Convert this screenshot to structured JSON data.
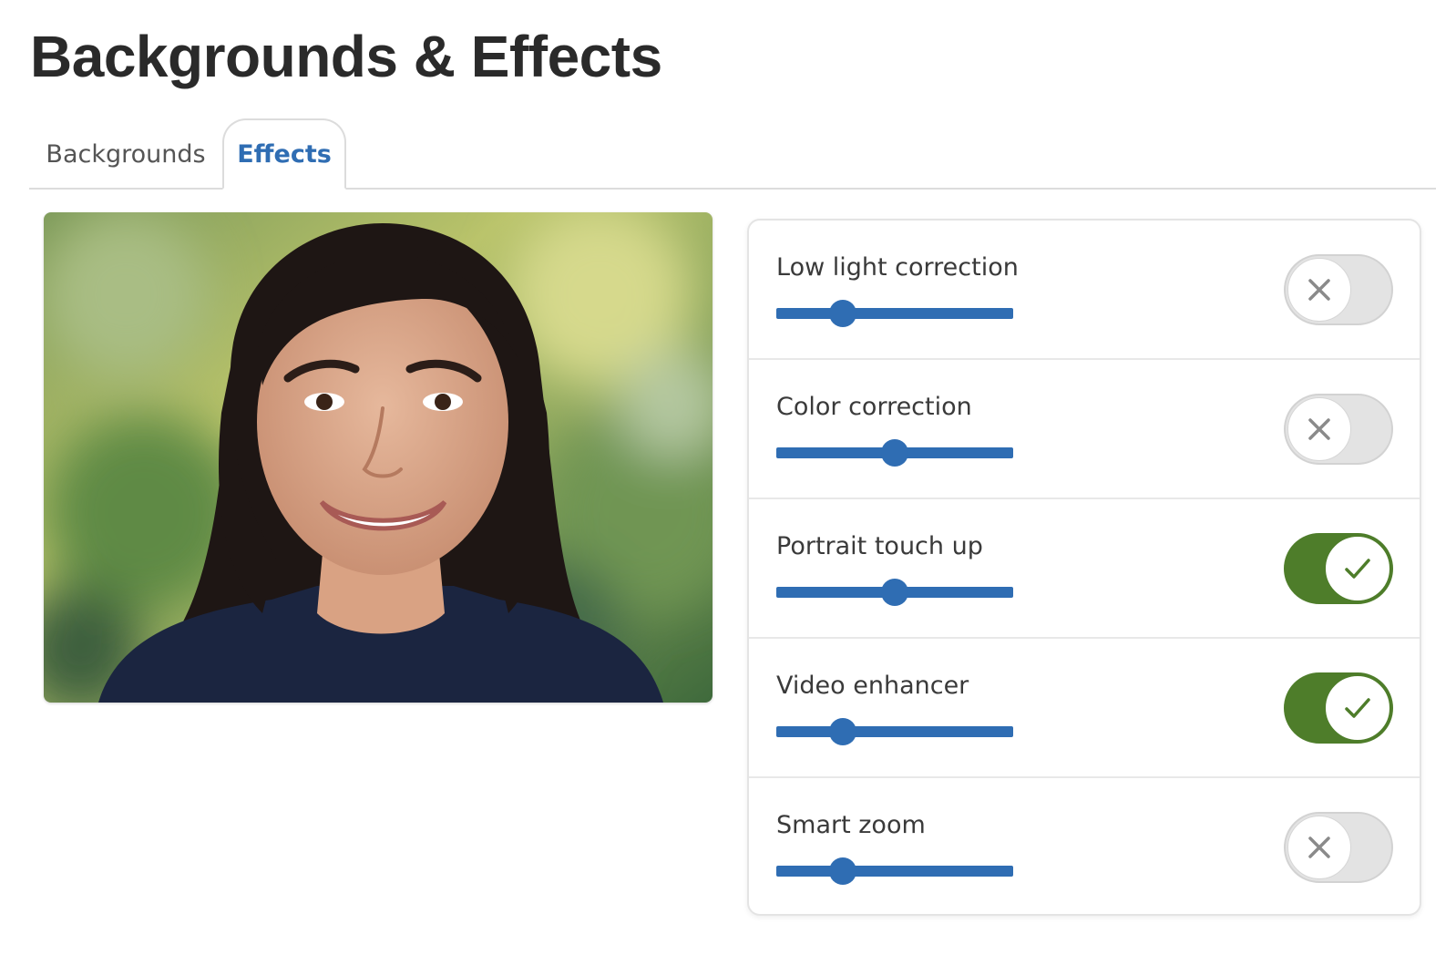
{
  "page": {
    "title": "Backgrounds & Effects"
  },
  "tabs": [
    {
      "label": "Backgrounds",
      "selected": false
    },
    {
      "label": "Effects",
      "selected": true
    }
  ],
  "preview": {
    "icon": "portrait-preview-image"
  },
  "effects": [
    {
      "label": "Low light correction",
      "level": 0.28,
      "enabled": false,
      "icon": "x-icon"
    },
    {
      "label": "Color correction",
      "level": 0.5,
      "enabled": false,
      "icon": "x-icon"
    },
    {
      "label": "Portrait touch up",
      "level": 0.5,
      "enabled": true,
      "icon": "check-icon"
    },
    {
      "label": "Video enhancer",
      "level": 0.28,
      "enabled": true,
      "icon": "check-icon"
    },
    {
      "label": "Smart zoom",
      "level": 0.28,
      "enabled": false,
      "icon": "x-icon"
    }
  ],
  "colors": {
    "accent": "#2f6db3",
    "toggle_on": "#4e7d2a",
    "toggle_off": "#e3e3e3",
    "icon_off": "#8a8a8a"
  }
}
